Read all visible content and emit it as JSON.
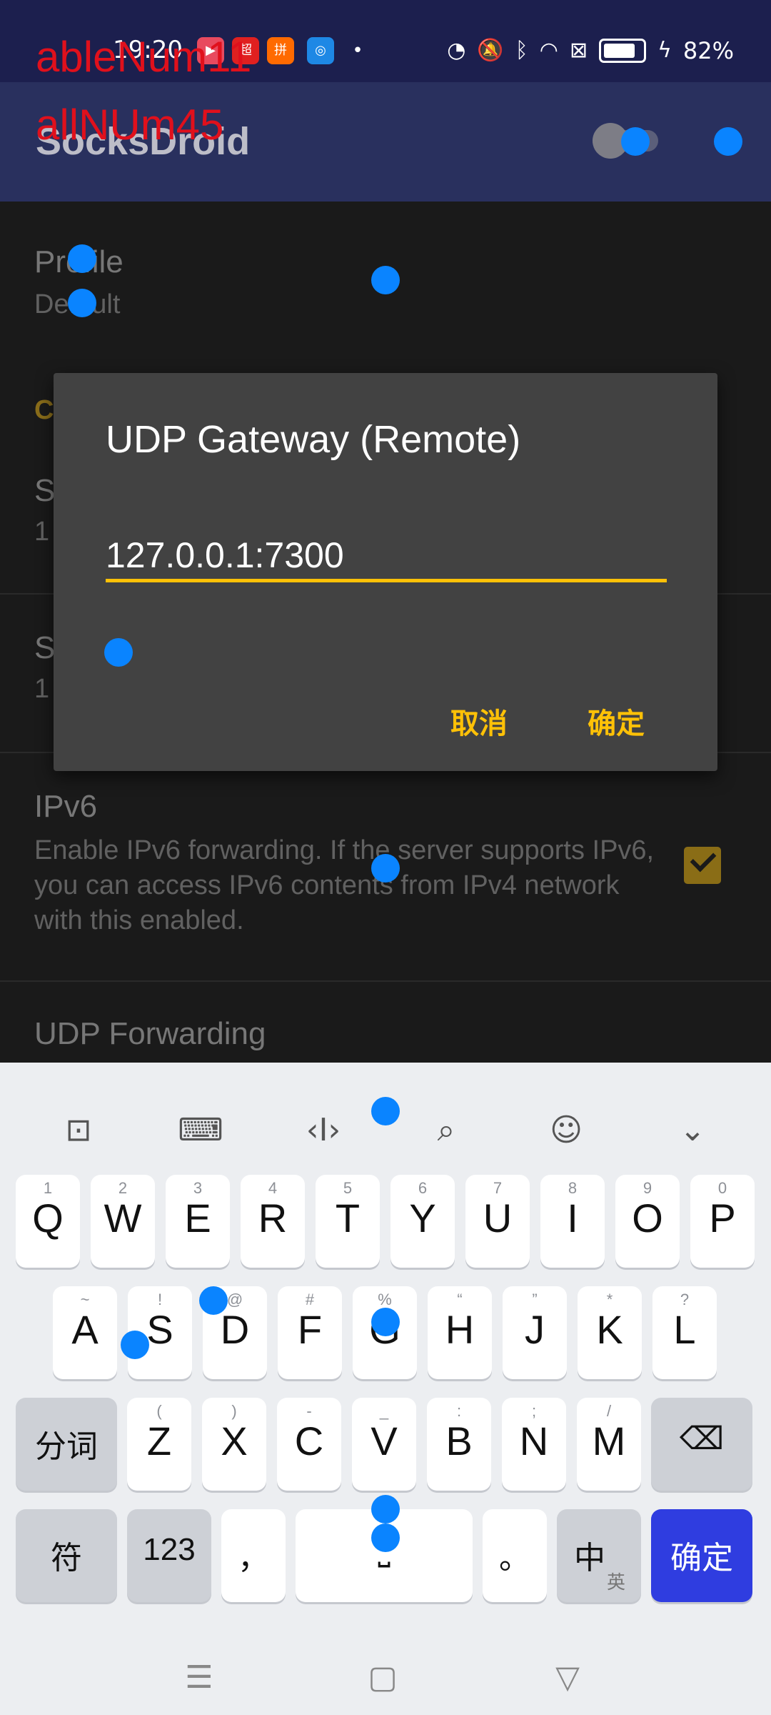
{
  "status_bar": {
    "time": "19:20",
    "battery_percent": "82%",
    "battery_level": 0.82,
    "notification_icons": [
      {
        "name": "video-app-icon",
        "color": "#e84a5f",
        "glyph": "▶"
      },
      {
        "name": "news-app-icon",
        "color": "#e02020",
        "glyph": "超"
      },
      {
        "name": "shopping-app-icon",
        "color": "#ff6a00",
        "glyph": "拼"
      },
      {
        "name": "browser-app-icon",
        "color": "#1e88e5",
        "glyph": "◎"
      }
    ]
  },
  "app_bar": {
    "title": "SocksDroid",
    "overlay_text_1": "ableNum11",
    "overlay_text_2": "allNUm45",
    "vpn_toggle": "off",
    "overflow_label": "⋮"
  },
  "preferences": {
    "profile_label": "Profile",
    "profile_value": "Default",
    "category_label": "C",
    "server_label": "S",
    "server_value": "1",
    "server_port_label": "S",
    "server_port_value": "1",
    "ipv6_label": "IPv6",
    "ipv6_desc": "Enable IPv6 forwarding. If the server supports IPv6, you can access IPv6 contents from IPv4 network with this enabled.",
    "ipv6_checked": true,
    "udp_label": "UDP Forwarding"
  },
  "dialog": {
    "title": "UDP Gateway (Remote)",
    "input_value": "127.0.0.1:7300",
    "cancel_label": "取消",
    "ok_label": "确定"
  },
  "keyboard": {
    "toolbar": [
      "clipboard-icon",
      "keyboard-icon",
      "cursor-icon",
      "search-icon",
      "emoji-icon",
      "collapse-icon"
    ],
    "row1": [
      [
        "1",
        "Q"
      ],
      [
        "2",
        "W"
      ],
      [
        "3",
        "E"
      ],
      [
        "4",
        "R"
      ],
      [
        "5",
        "T"
      ],
      [
        "6",
        "Y"
      ],
      [
        "7",
        "U"
      ],
      [
        "8",
        "I"
      ],
      [
        "9",
        "O"
      ],
      [
        "0",
        "P"
      ]
    ],
    "row2": [
      [
        "~",
        "A"
      ],
      [
        "!",
        "S"
      ],
      [
        "@",
        "D"
      ],
      [
        "#",
        "F"
      ],
      [
        "%",
        "G"
      ],
      [
        "“",
        "H"
      ],
      [
        "”",
        "J"
      ],
      [
        "*",
        "K"
      ],
      [
        "?",
        "L"
      ]
    ],
    "row3": [
      [
        "(",
        "Z"
      ],
      [
        ")",
        "X"
      ],
      [
        "-",
        "C"
      ],
      [
        "_",
        "V"
      ],
      [
        ":",
        "B"
      ],
      [
        ";",
        "N"
      ],
      [
        "/",
        "M"
      ]
    ],
    "segment_label": "分词",
    "symbol_label": "符",
    "numbers_label": "123",
    "comma_label": "，",
    "period_label": "。",
    "lang_label": "中",
    "lang_sub": "英",
    "enter_label": "确定"
  },
  "colors": {
    "accent": "#ffc107",
    "app_bar": "#29305e",
    "enter_key": "#2f3de0",
    "touch_marker": "#0a84ff"
  }
}
